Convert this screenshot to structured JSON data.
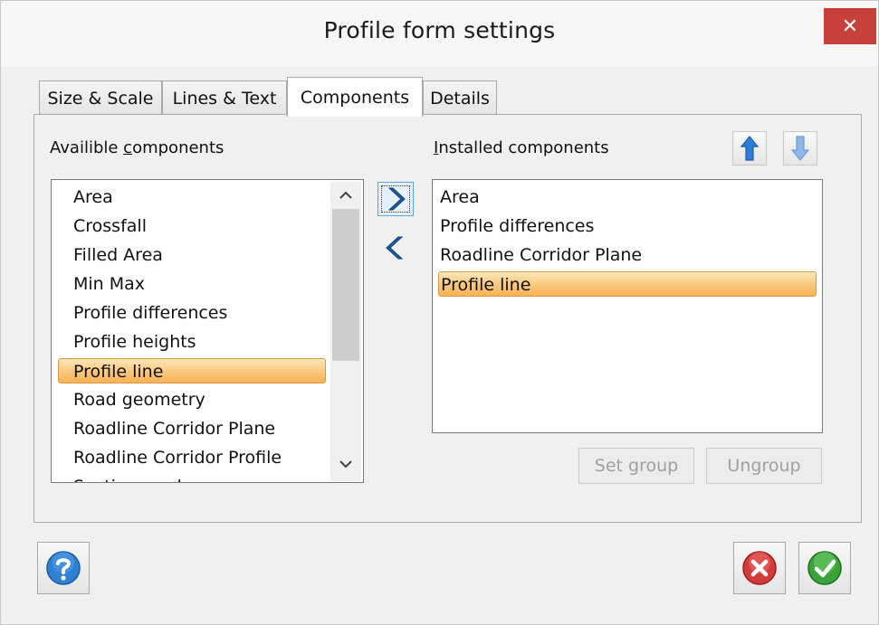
{
  "window": {
    "title": "Profile form settings",
    "close_label": "✕"
  },
  "tabs": [
    {
      "label": "Size & Scale"
    },
    {
      "label": "Lines & Text"
    },
    {
      "label": "Components"
    },
    {
      "label": "Details"
    }
  ],
  "available": {
    "label_prefix": "Availible ",
    "label_accel": "c",
    "label_suffix": "omponents",
    "items": [
      "Area",
      "Crossfall",
      "Filled Area",
      "Min Max",
      "Profile differences",
      "Profile heights",
      "Profile line",
      "Road geometry",
      "Roadline Corridor Plane",
      "Roadline Corridor Profile",
      "Section marks"
    ],
    "selected_index": 6
  },
  "installed": {
    "label_accel": "I",
    "label_suffix": "nstalled components",
    "items": [
      "Area",
      "Profile differences",
      "Roadline Corridor Plane",
      "Profile line"
    ],
    "selected_index": 3
  },
  "buttons": {
    "set_group": "Set group",
    "ungroup": "Ungroup"
  },
  "colors": {
    "accent_blue": "#2d7fd6",
    "close_red": "#c7403a",
    "ok_green": "#3aa43a",
    "cancel_red": "#d23a3a",
    "selection": "#f9c77b"
  },
  "icons": {
    "move_right": "chevron-right-icon",
    "move_left": "chevron-left-icon",
    "move_up": "arrow-up-icon",
    "move_down": "arrow-down-icon",
    "help": "help-icon",
    "cancel": "cancel-icon",
    "ok": "ok-icon"
  }
}
